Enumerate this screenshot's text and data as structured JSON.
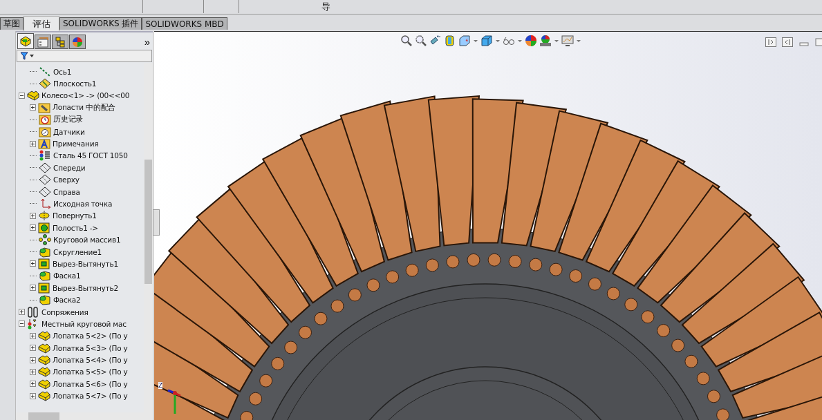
{
  "ribbon": {
    "visible_text": "导"
  },
  "tabs": [
    {
      "label": "草图",
      "selected": false
    },
    {
      "label": "评估",
      "selected": true
    },
    {
      "label": "SOLIDWORKS 插件",
      "selected": false
    },
    {
      "label": "SOLIDWORKS MBD",
      "selected": false
    }
  ],
  "panel_tabs": [
    {
      "kind": "feature-tree",
      "selected": true
    },
    {
      "kind": "property",
      "selected": false
    },
    {
      "kind": "configuration",
      "selected": false
    },
    {
      "kind": "appearance",
      "selected": false
    }
  ],
  "panel_more": "»",
  "tree": {
    "continued_children": [
      {
        "label": "Ось1",
        "kind": "axis"
      },
      {
        "label": "Плоскость1",
        "kind": "plane"
      }
    ],
    "items": [
      {
        "label": "Колесо<1> -> (00<<00",
        "kind": "part",
        "expanded": true,
        "children": [
          {
            "label": "Лопасти 中的配合",
            "kind": "mates-folder",
            "expanded": false
          },
          {
            "label": "历史记录",
            "kind": "history"
          },
          {
            "label": "Датчики",
            "kind": "sensors"
          },
          {
            "label": "Примечания",
            "kind": "annotations",
            "expanded": false
          },
          {
            "label": "Сталь 45 ГОСТ 1050",
            "kind": "material"
          },
          {
            "label": "Спереди",
            "kind": "plane-outline"
          },
          {
            "label": "Сверху",
            "kind": "plane-outline"
          },
          {
            "label": "Справа",
            "kind": "plane-outline"
          },
          {
            "label": "Исходная точка",
            "kind": "origin"
          },
          {
            "label": "Повернуть1",
            "kind": "revolve",
            "expanded": false
          },
          {
            "label": "Полость1 ->",
            "kind": "cavity",
            "expanded": false
          },
          {
            "label": "Круговой массив1",
            "kind": "pattern"
          },
          {
            "label": "Скругление1",
            "kind": "fillet"
          },
          {
            "label": "Вырез-Вытянуть1",
            "kind": "cut",
            "expanded": false
          },
          {
            "label": "Фаска1",
            "kind": "fillet"
          },
          {
            "label": "Вырез-Вытянуть2",
            "kind": "cut",
            "expanded": false
          },
          {
            "label": "Фаска2",
            "kind": "fillet"
          }
        ]
      },
      {
        "label": "Сопряжения",
        "kind": "mates",
        "expanded": false
      },
      {
        "label": "Местный круговой мас",
        "kind": "local-pattern",
        "expanded": true,
        "children": [
          {
            "label": "Лопатка 5<2> (По у",
            "kind": "part",
            "expanded": false
          },
          {
            "label": "Лопатка 5<3> (По у",
            "kind": "part",
            "expanded": false
          },
          {
            "label": "Лопатка 5<4> (По у",
            "kind": "part",
            "expanded": false
          },
          {
            "label": "Лопатка 5<5> (По у",
            "kind": "part",
            "expanded": false
          },
          {
            "label": "Лопатка 5<6> (По у",
            "kind": "part",
            "expanded": false
          },
          {
            "label": "Лопатка 5<7> (По у",
            "kind": "part",
            "expanded": false
          }
        ]
      }
    ]
  },
  "view_toolbar": [
    {
      "kind": "zoom-fit",
      "dropdown": false
    },
    {
      "kind": "zoom-area",
      "dropdown": false
    },
    {
      "kind": "previous-view",
      "dropdown": false
    },
    {
      "kind": "section",
      "dropdown": false
    },
    {
      "kind": "view-orientation",
      "dropdown": true
    },
    {
      "kind": "display-style",
      "dropdown": true
    },
    {
      "kind": "hide-show",
      "dropdown": true
    },
    {
      "kind": "appearance",
      "dropdown": false
    },
    {
      "kind": "scene",
      "dropdown": true
    },
    {
      "kind": "view-settings",
      "dropdown": true
    }
  ],
  "triad_label": "Z"
}
